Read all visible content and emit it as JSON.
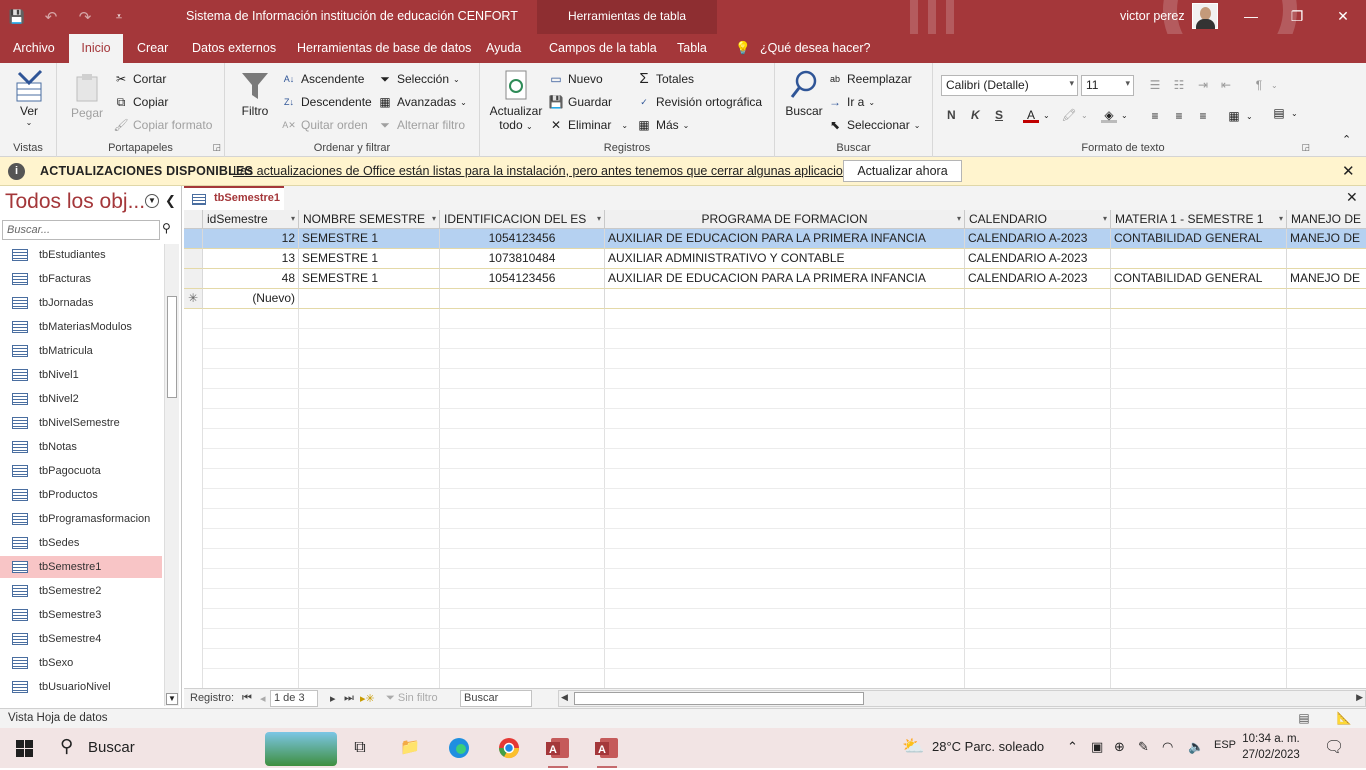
{
  "window": {
    "title": "Sistema de Información institución de educación CENFORT",
    "context_tab": "Herramientas de tabla",
    "user": "victor perez",
    "buttons": {
      "minimize": "—",
      "maximize": "❐",
      "close": "✕"
    },
    "accent": "#a4373a"
  },
  "qat": {
    "save": "💾",
    "undo": "↶",
    "redo": "↷",
    "customize": "⩡"
  },
  "menu_tabs": [
    "Archivo",
    "Inicio",
    "Crear",
    "Datos externos",
    "Herramientas de base de datos",
    "Ayuda",
    "Campos de la tabla",
    "Tabla"
  ],
  "tell_me": "¿Qué desea hacer?",
  "ribbon": {
    "vistas": {
      "label": "Vistas",
      "ver": "Ver"
    },
    "portapapeles": {
      "label": "Portapapeles",
      "pegar": "Pegar",
      "cortar": "Cortar",
      "copiar": "Copiar",
      "copiar_formato": "Copiar formato"
    },
    "ordenar": {
      "label": "Ordenar y filtrar",
      "filtro": "Filtro",
      "ascendente": "Ascendente",
      "descendente": "Descendente",
      "quitar_orden": "Quitar orden",
      "seleccion": "Selección",
      "avanzadas": "Avanzadas",
      "alternar_filtro": "Alternar filtro"
    },
    "registros": {
      "label": "Registros",
      "actualizar": "Actualizar",
      "todo": "todo",
      "nuevo": "Nuevo",
      "guardar": "Guardar",
      "eliminar": "Eliminar",
      "totales": "Totales",
      "revision": "Revisión ortográfica",
      "mas": "Más"
    },
    "buscar": {
      "label": "Buscar",
      "buscar": "Buscar",
      "reemplazar": "Reemplazar",
      "ira": "Ir a",
      "seleccionar": "Seleccionar"
    },
    "formato": {
      "label": "Formato de texto",
      "font": "Calibri (Detalle)",
      "size": "11",
      "bold": "N",
      "italic": "K",
      "underline": "S"
    }
  },
  "message_bar": {
    "heading": "ACTUALIZACIONES DISPONIBLES",
    "text": "Las actualizaciones de Office están listas para la instalación, pero antes tenemos que cerrar algunas aplicaciones.",
    "button": "Actualizar ahora"
  },
  "nav": {
    "title": "Todos los obj...",
    "search_placeholder": "Buscar...",
    "items": [
      "tbEstudiantes",
      "tbFacturas",
      "tbJornadas",
      "tbMateriasModulos",
      "tbMatricula",
      "tbNivel1",
      "tbNivel2",
      "tbNivelSemestre",
      "tbNotas",
      "tbPagocuota",
      "tbProductos",
      "tbProgramasformacion",
      "tbSedes",
      "tbSemestre1",
      "tbSemestre2",
      "tbSemestre3",
      "tbSemestre4",
      "tbSexo",
      "tbUsuarioNivel"
    ],
    "selected": "tbSemestre1"
  },
  "doc_tab": "tbSemestre1",
  "table": {
    "columns": [
      "idSemestre",
      "NOMBRE SEMESTRE",
      "IDENTIFICACION DEL ES",
      "PROGRAMA DE FORMACION",
      "CALENDARIO",
      "MATERIA 1 - SEMESTRE 1",
      "MANEJO DE"
    ],
    "rows": [
      [
        "12",
        "SEMESTRE 1",
        "1054123456",
        "AUXILIAR DE EDUCACION PARA LA PRIMERA INFANCIA",
        "CALENDARIO A-2023",
        "CONTABILIDAD GENERAL",
        "MANEJO DE"
      ],
      [
        "13",
        "SEMESTRE 1",
        "1073810484",
        "AUXILIAR ADMINISTRATIVO Y CONTABLE",
        "CALENDARIO A-2023",
        "",
        ""
      ],
      [
        "48",
        "SEMESTRE 1",
        "1054123456",
        "AUXILIAR DE EDUCACION PARA LA PRIMERA INFANCIA",
        "CALENDARIO A-2023",
        "CONTABILIDAD GENERAL",
        "MANEJO DE"
      ]
    ],
    "new_row": "(Nuevo)",
    "new_marker": "✳"
  },
  "record_nav": {
    "label": "Registro:",
    "position": "1 de 3",
    "filter": "Sin filtro",
    "search": "Buscar"
  },
  "status_bar": {
    "text": "Vista Hoja de datos"
  },
  "taskbar": {
    "search": "Buscar",
    "weather": "28°C  Parc. soleado",
    "lang": "ESP",
    "time": "10:34 a. m.",
    "date": "27/02/2023"
  }
}
